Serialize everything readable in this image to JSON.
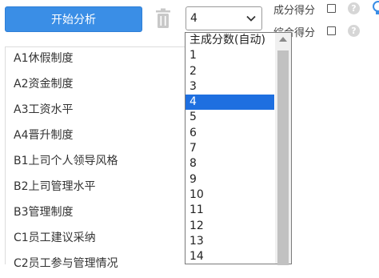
{
  "toolbar": {
    "start_label": "开始分析",
    "select_value": "4",
    "option1_label": "成分得分",
    "option2_label": "综合得分",
    "help_glyph": "?"
  },
  "list": {
    "items": [
      "A1休假制度",
      "A2资金制度",
      "A3工资水平",
      "A4晋升制度",
      "B1上司个人领导风格",
      "B2上司管理水平",
      "B3管理制度",
      "C1员工建议采纳",
      "C2员工参与管理情况"
    ]
  },
  "dropdown": {
    "options": [
      "主成分数(自动)",
      "1",
      "2",
      "3",
      "4",
      "5",
      "6",
      "7",
      "8",
      "9",
      "10",
      "11",
      "12",
      "13",
      "14"
    ],
    "selected": "4"
  },
  "colors": {
    "accent": "#3a8ee6",
    "selected_option": "#1e6fe0"
  }
}
